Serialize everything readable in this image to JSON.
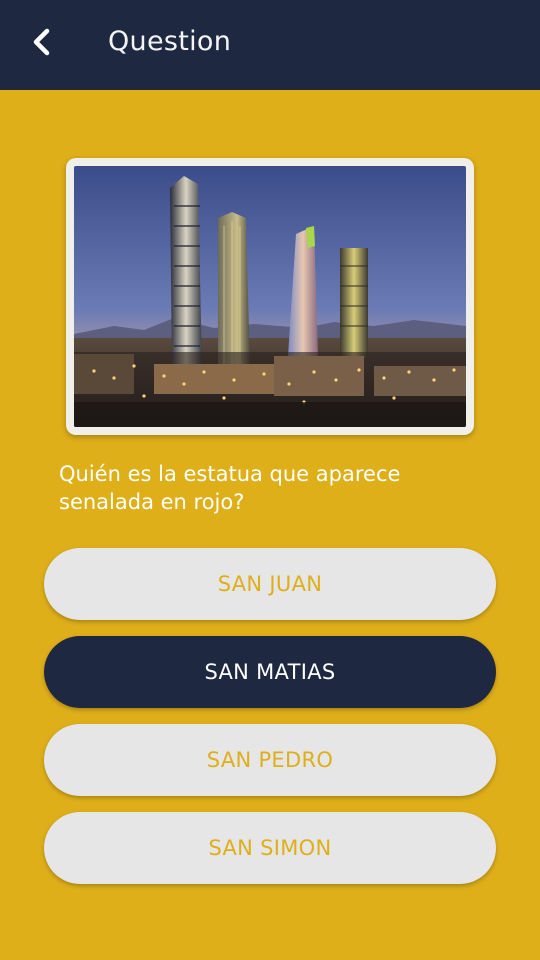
{
  "header": {
    "back_icon": "chevron-left-icon",
    "title": "Question"
  },
  "image": {
    "description_icon": "city-skyline-photo"
  },
  "question": {
    "text": "Quién es la estatua que aparece senalada en rojo?"
  },
  "answers": [
    {
      "label": "SAN JUAN",
      "selected": false
    },
    {
      "label": "SAN MATIAS",
      "selected": true
    },
    {
      "label": "SAN PEDRO",
      "selected": false
    },
    {
      "label": "SAN SIMON",
      "selected": false
    }
  ],
  "colors": {
    "background": "#DFAF1A",
    "header": "#1F2841",
    "answer_default": "#E6E6E6",
    "answer_selected": "#1F2841",
    "answer_text_default": "#DFAF1A",
    "answer_text_selected": "#FFFFFF"
  }
}
